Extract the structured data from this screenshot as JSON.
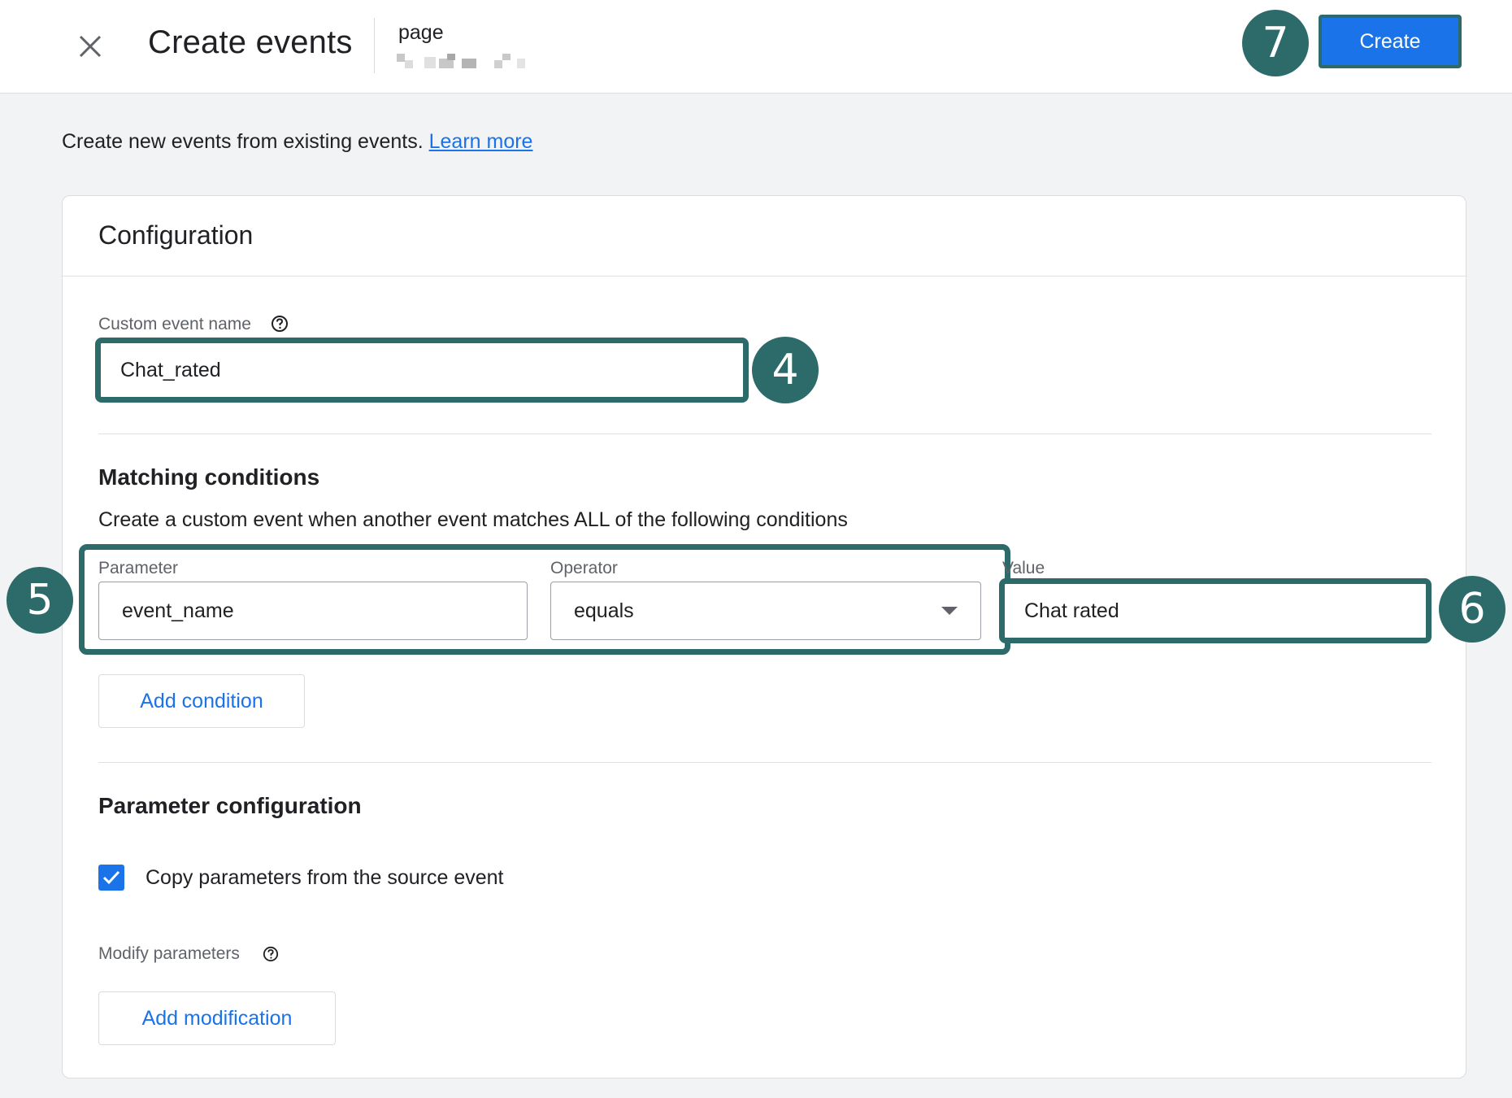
{
  "header": {
    "title": "Create events",
    "property_name": "page",
    "create_label": "Create"
  },
  "intro": {
    "text": "Create new events from existing events.",
    "learn_more": "Learn more"
  },
  "config": {
    "title": "Configuration",
    "custom_event_label": "Custom event name",
    "custom_event_value": "Chat_rated",
    "matching": {
      "title": "Matching conditions",
      "description": "Create a custom event when another event matches ALL of the following conditions",
      "parameter_label": "Parameter",
      "parameter_value": "event_name",
      "operator_label": "Operator",
      "operator_value": "equals",
      "value_label": "Value",
      "value_value": "Chat rated",
      "add_condition": "Add condition"
    },
    "param_config": {
      "title": "Parameter configuration",
      "copy_label": "Copy parameters from the source event",
      "copy_checked": true,
      "modify_label": "Modify parameters",
      "add_modification": "Add modification"
    }
  },
  "badges": {
    "b4": "4",
    "b5": "5",
    "b6": "6",
    "b7": "7",
    "color": "#2c6b6a"
  },
  "icons": {
    "close": "close-icon",
    "help": "help-circle-icon",
    "dropdown": "arrow-drop-down-icon",
    "check": "check-icon"
  },
  "colors": {
    "accent": "#1a73e8",
    "highlight": "#2c6b6a",
    "page_bg": "#f1f3f4"
  }
}
